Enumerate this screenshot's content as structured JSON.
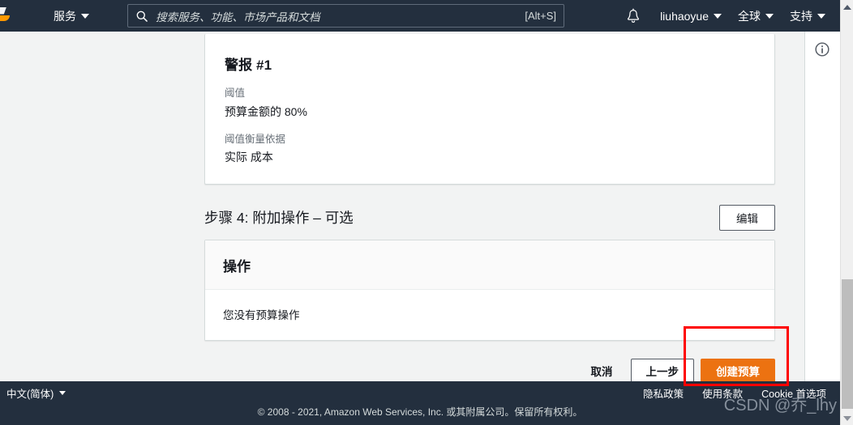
{
  "topnav": {
    "logo_name": "aws-logo",
    "services_label": "服务",
    "search": {
      "placeholder": "搜索服务、功能、市场产品和文档",
      "shortcut": "[Alt+S]",
      "icon": "search-icon"
    },
    "bell_icon": "notifications-bell-icon",
    "account_label": "liuhaoyue",
    "region_label": "全球",
    "support_label": "支持"
  },
  "right_rail": {
    "info_icon": "info-circle-icon"
  },
  "alarm_card": {
    "title": "警报 #1",
    "threshold_label": "阈值",
    "threshold_value": "预算金额的 80%",
    "measure_label": "阈值衡量依据",
    "measure_value": "实际 成本"
  },
  "step4": {
    "title": "步骤 4: 附加操作 – 可选",
    "edit_label": "编辑",
    "panel": {
      "header": "操作",
      "empty_text": "您没有预算操作"
    }
  },
  "actions": {
    "cancel_label": "取消",
    "previous_label": "上一步",
    "create_label": "创建预算",
    "primary_color": "#ec7211",
    "annotation_color": "#fe0000"
  },
  "footer": {
    "language_label": "中文(简体)",
    "links": [
      "隐私政策",
      "使用条款",
      "Cookie 首选项"
    ],
    "copyright": "© 2008 - 2021, Amazon Web Services, Inc. 或其附属公司。保留所有权利。"
  },
  "watermark": {
    "text": "CSDN @乔_lhy"
  },
  "scrollbar": {
    "up_icon": "scroll-up-arrow-icon",
    "down_icon": "scroll-down-arrow-icon"
  }
}
